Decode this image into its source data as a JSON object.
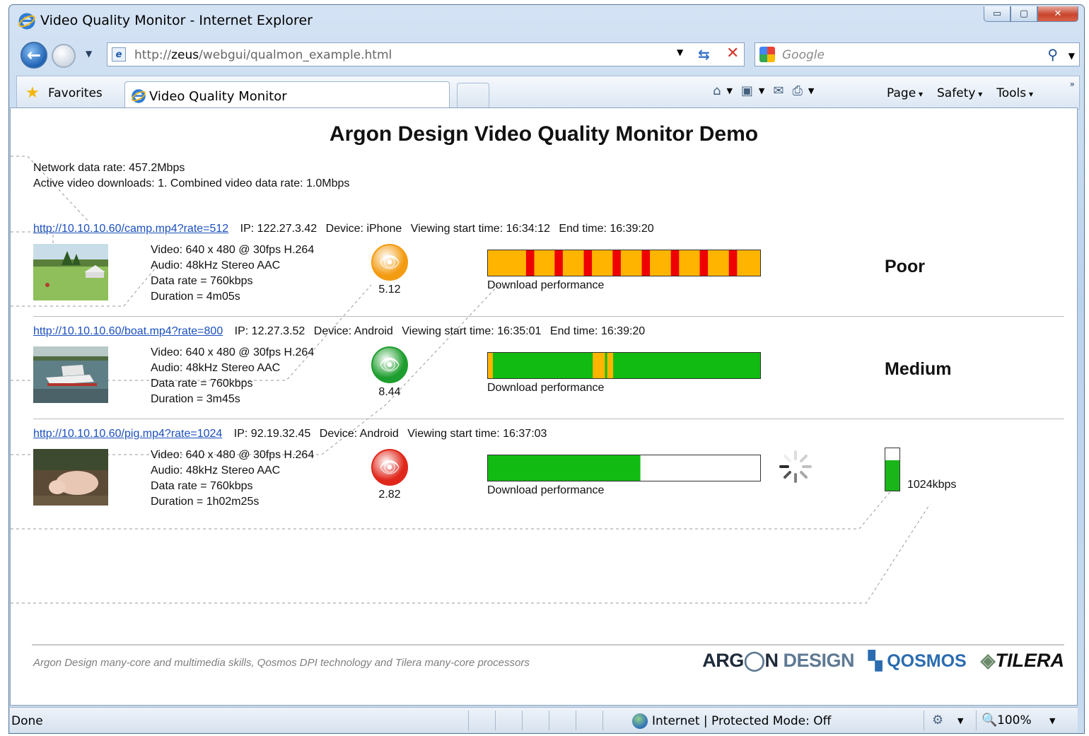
{
  "window": {
    "title": "Video Quality Monitor - Internet Explorer",
    "icon": "ie-icon",
    "controls": [
      "minimize-icon",
      "maximize-icon",
      "close-icon"
    ]
  },
  "nav": {
    "url_prefix": "http://",
    "url_host": "zeus",
    "url_path": "/webgui/qualmon_example.html",
    "search_placeholder": "Google"
  },
  "command_bar": {
    "favorites_label": "Favorites",
    "tab_label": "Video Quality Monitor",
    "menus": [
      "Page",
      "Safety",
      "Tools"
    ]
  },
  "page": {
    "title": "Argon Design Video Quality Monitor Demo",
    "network_rate": "Network data rate: 457.2Mbps",
    "active_downloads": "Active video downloads: 1. Combined video data rate: 1.0Mbps",
    "bar_label": "Download performance",
    "streams": [
      {
        "url": "http://10.10.10.60/camp.mp4?rate=512",
        "ip": "IP: 122.27.3.42",
        "device": "Device: iPhone",
        "start": "Viewing start time: 16:34:12",
        "end": "End time: 16:39:20",
        "video": "Video: 640 x 480 @ 30fps H.264",
        "audio": "Audio: 48kHz Stereo AAC",
        "data_rate": "Data rate = 760kbps",
        "duration": "Duration = 4m05s",
        "score": "5.12",
        "eye_color": "#f39c12",
        "quality": "Poor",
        "performance": {
          "base_color": "#ffb400",
          "stall_color": "#ee0000",
          "stall_starts": [
            0.14,
            0.245,
            0.352,
            0.458,
            0.565,
            0.672,
            0.778,
            0.885
          ],
          "stall_width": 0.03,
          "filled": 1.0
        }
      },
      {
        "url": "http://10.10.10.60/boat.mp4?rate=800",
        "ip": "IP: 12.27.3.52",
        "device": "Device: Android",
        "start": "Viewing start time: 16:35:01",
        "end": "End time: 16:39:20",
        "video": "Video: 640 x 480 @ 30fps H.264",
        "audio": "Audio: 48kHz Stereo AAC",
        "data_rate": "Data rate = 760kbps",
        "duration": "Duration = 3m45s",
        "score": "8.44",
        "eye_color": "#1e9e2e",
        "quality": "Medium",
        "performance": {
          "base_color": "#11bb11",
          "segments": [
            {
              "from": 0.0,
              "to": 0.018,
              "color": "#ffb400"
            },
            {
              "from": 0.385,
              "to": 0.43,
              "color": "#ffb400"
            },
            {
              "from": 0.43,
              "to": 0.438,
              "color": "#11bb11"
            },
            {
              "from": 0.438,
              "to": 0.46,
              "color": "#ffb400"
            }
          ],
          "filled": 1.0
        }
      },
      {
        "url": "http://10.10.10.60/pig.mp4?rate=1024",
        "ip": "IP: 92.19.32.45",
        "device": "Device: Android",
        "start": "Viewing start time: 16:37:03",
        "end": "",
        "video": "Video: 640 x 480 @ 30fps H.264",
        "audio": "Audio: 48kHz Stereo AAC",
        "data_rate": "Data rate = 760kbps",
        "duration": "Duration = 1h02m25s",
        "score": "2.82",
        "eye_color": "#e0271b",
        "quality": "",
        "rate_label": "1024kbps",
        "rate_level": 0.72,
        "performance": {
          "base_color": "#11bb11",
          "filled": 0.56
        }
      }
    ],
    "footer_text": "Argon Design many-core and multimedia skills, Qosmos DPI technology and Tilera many-core processors",
    "logos": {
      "argon_1": "ARG",
      "argon_2": "N",
      "argon_3": "DESIGN",
      "qosmos": "QOSMOS",
      "tilera": "TILERA"
    }
  },
  "status": {
    "left": "Done",
    "zone": "Internet | Protected Mode: Off",
    "zoom": "100%"
  }
}
